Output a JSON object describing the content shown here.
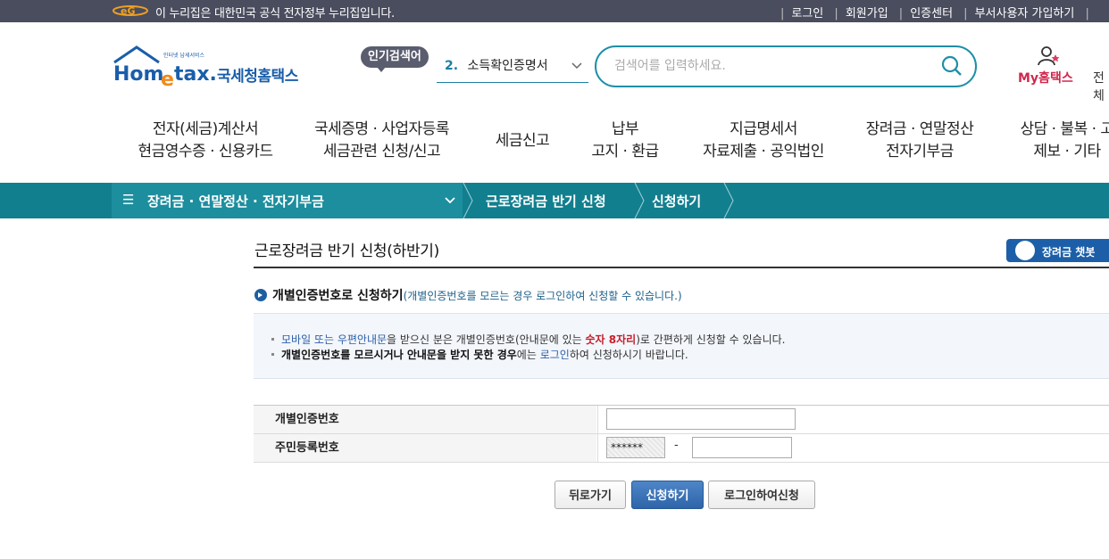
{
  "topbar": {
    "notice": "이 누리집은 대한민국 공식 전자정부 누리집입니다.",
    "links": [
      "로그인",
      "회원가입",
      "인증센터",
      "부서사용자 가입하기"
    ]
  },
  "header": {
    "logo_small": "인터넷 납세서비스",
    "logo_text": "국세청홈택스",
    "popular_badge": "인기검색어",
    "popular_num": "2.",
    "popular_keyword": "소득확인증명서",
    "search_placeholder": "검색어를 입력하세요.",
    "my_home": "My홈택스",
    "all_menu": "전체"
  },
  "gnb": [
    {
      "line1": "전자(세금)계산서",
      "line2": "현금영수증 · 신용카드"
    },
    {
      "line1": "국세증명 · 사업자등록",
      "line2": "세금관련 신청/신고"
    },
    {
      "line1": "세금신고",
      "line2": ""
    },
    {
      "line1": "납부",
      "line2": "고지 · 환급"
    },
    {
      "line1": "지급명세서",
      "line2": "자료제출 · 공익법인"
    },
    {
      "line1": "장려금 · 연말정산",
      "line2": "전자기부금"
    },
    {
      "line1": "상담 · 불복 · 고",
      "line2": "제보 · 기타"
    }
  ],
  "breadcrumb": {
    "menu": "장려금 · 연말정산 · 전자기부금",
    "level2": "근로장려금 반기 신청",
    "level3": "신청하기"
  },
  "page": {
    "title": "근로장려금 반기 신청(하반기)",
    "chatbot": "장려금 챗봇",
    "section_title": "개별인증번호로 신청하기",
    "section_note": "(개별인증번호를 모르는 경우 로그인하여 신청할 수 있습니다.)"
  },
  "info": {
    "l1_a": "모바일 또는 우편안내문",
    "l1_b": "을 받으신 분은 개별인증번호(안내문에 있는 ",
    "l1_c": "숫자 8자리",
    "l1_d": ")로 간편하게 신청할 수 있습니다.",
    "l2_a": "개별인증번호를 모르시거나 안내문을 받지 못한 경우",
    "l2_b": "에는 ",
    "l2_c": "로그인",
    "l2_d": "하여 신청하시기 바랍니다."
  },
  "form": {
    "auth_label": "개별인증번호",
    "auth_value": "",
    "rrn_label": "주민등록번호",
    "rrn_front": "******",
    "rrn_dash": "-",
    "rrn_back": ""
  },
  "buttons": {
    "back": "뒤로가기",
    "apply": "신청하기",
    "login_apply": "로그인하여신청"
  },
  "colors": {
    "topbar": "#4a4d5e",
    "breadcrumb": "#127f8f",
    "accent": "#1e8fa8",
    "primary_button": "#2e64a8"
  }
}
